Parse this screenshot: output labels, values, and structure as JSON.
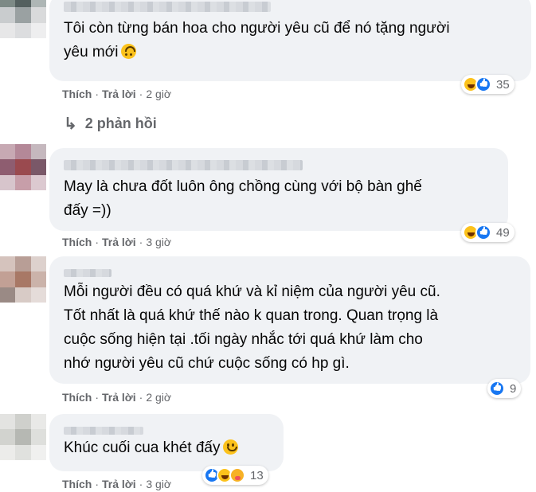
{
  "comments": [
    {
      "text_lines": [
        "Tôi còn từng bán hoa cho người yêu cũ để nó tặng người",
        "yêu mới"
      ],
      "emoji": "upside-down-face",
      "reactions": [
        "haha",
        "like"
      ],
      "reaction_count": "35",
      "like_label": "Thích",
      "reply_label": "Trả lời",
      "time": "2 giờ",
      "replies_label": "2 phản hồi"
    },
    {
      "text_lines": [
        "May là chưa đốt luôn ông chồng cùng với bộ bàn ghế",
        "đấy =))"
      ],
      "reactions": [
        "haha",
        "like"
      ],
      "reaction_count": "49",
      "like_label": "Thích",
      "reply_label": "Trả lời",
      "time": "3 giờ"
    },
    {
      "text_lines": [
        "Mỗi người đều có quá khứ và kỉ niệm của người yêu cũ.",
        "Tốt nhất là quá khứ thế nào k quan trong. Quan trọng là",
        "cuộc sống hiện tại .tối ngày nhắc tới quá khứ làm cho",
        "nhớ người yêu cũ chứ cuộc sống có hp gì."
      ],
      "reactions": [
        "like"
      ],
      "reaction_count": "9",
      "like_label": "Thích",
      "reply_label": "Trả lời",
      "time": "2 giờ"
    },
    {
      "text_lines": [
        "Khúc cuối cua khét đấy"
      ],
      "emoji": "smiling-face",
      "reactions": [
        "like",
        "haha",
        "care"
      ],
      "reaction_count": "13",
      "like_label": "Thích",
      "reply_label": "Trả lời",
      "time": "3 giờ"
    }
  ],
  "separator": "·",
  "colors": {
    "bubble": "#f0f2f5",
    "meta": "#65676b",
    "like_blue": "#1877f2"
  }
}
